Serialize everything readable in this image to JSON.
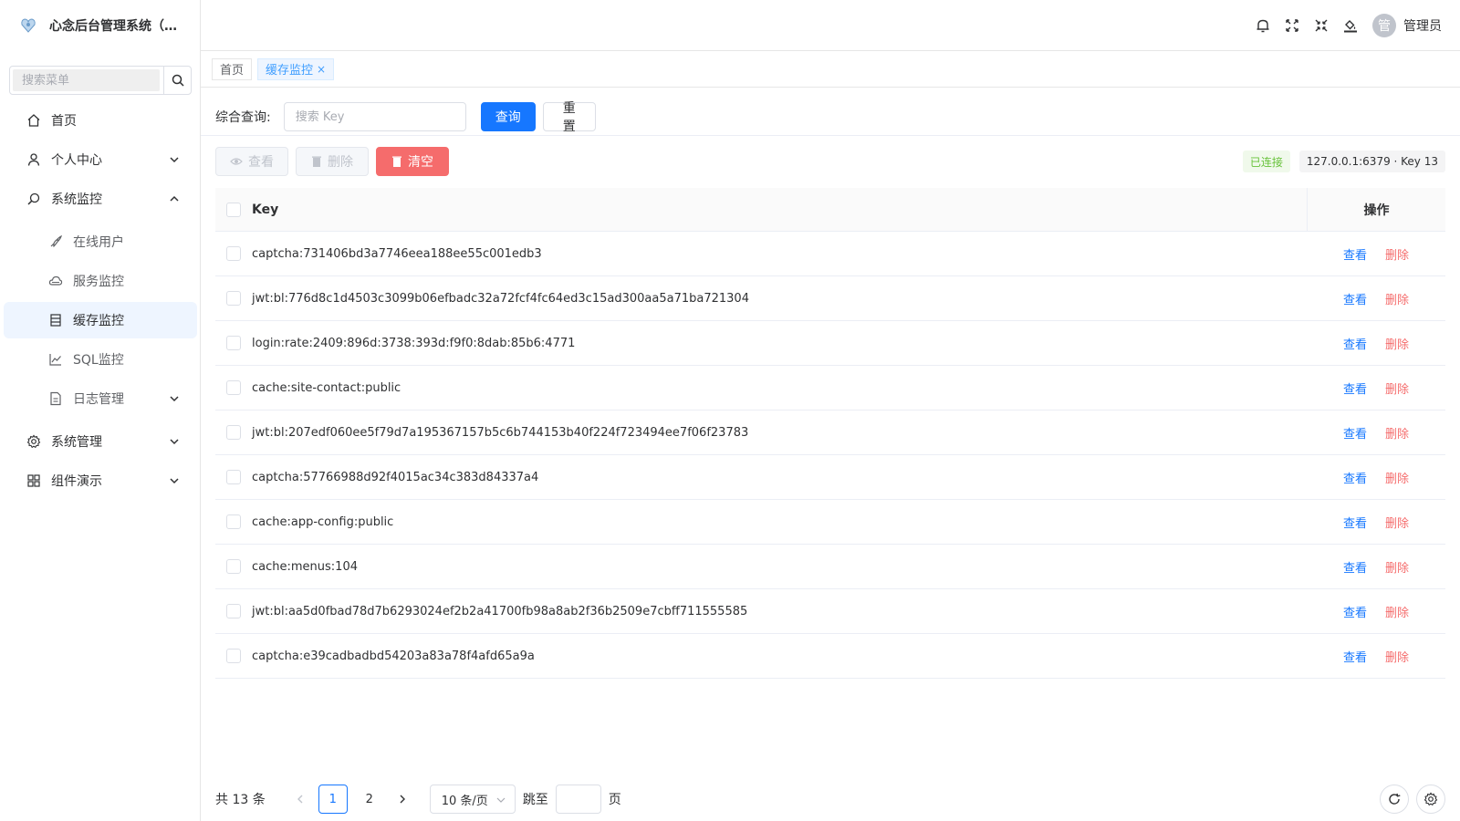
{
  "app": {
    "title": "心念后台管理系统（R..."
  },
  "sidebar": {
    "search_placeholder": "搜索菜单",
    "items": [
      {
        "label": "首页",
        "icon": "home-icon"
      },
      {
        "label": "个人中心",
        "icon": "user-icon"
      },
      {
        "label": "系统监控",
        "icon": "monitor-icon"
      },
      {
        "label": "在线用户",
        "icon": "rocket-icon"
      },
      {
        "label": "服务监控",
        "icon": "cloud-icon"
      },
      {
        "label": "缓存监控",
        "icon": "cache-icon"
      },
      {
        "label": "SQL监控",
        "icon": "line-chart-icon"
      },
      {
        "label": "日志管理",
        "icon": "document-icon"
      },
      {
        "label": "系统管理",
        "icon": "gear-icon"
      },
      {
        "label": "组件演示",
        "icon": "grid-icon"
      }
    ]
  },
  "header": {
    "avatar_text": "管",
    "user_name": "管理员"
  },
  "tabs": [
    {
      "label": "首页"
    },
    {
      "label": "缓存监控",
      "close": "×"
    }
  ],
  "query": {
    "label": "综合查询:",
    "placeholder": "搜索 Key",
    "search_label": "查询",
    "reset_label": "重置"
  },
  "toolbar": {
    "view_label": "查看",
    "delete_label": "删除",
    "clear_label": "清空",
    "status": "已连接",
    "server_info": "127.0.0.1:6379 · Key 13"
  },
  "table": {
    "columns": [
      "Key",
      "操作"
    ],
    "view_label": "查看",
    "delete_label": "删除",
    "rows": [
      "captcha:731406bd3a7746eea188ee55c001edb3",
      "jwt:bl:776d8c1d4503c3099b06efbadc32a72fcf4fc64ed3c15ad300aa5a71ba721304",
      "login:rate:2409:896d:3738:393d:f9f0:8dab:85b6:4771",
      "cache:site-contact:public",
      "jwt:bl:207edf060ee5f79d7a195367157b5c6b744153b40f224f723494ee7f06f23783",
      "captcha:57766988d92f4015ac34c383d84337a4",
      "cache:app-config:public",
      "cache:menus:104",
      "jwt:bl:aa5d0fbad78d7b6293024ef2b2a41700fb98a8ab2f36b2509e7cbff711555585",
      "captcha:e39cadbadbd54203a83a78f4afd65a9a"
    ]
  },
  "pagination": {
    "total": "共 13 条",
    "pages": [
      "1",
      "2"
    ],
    "current": "1",
    "page_size": "10 条/页",
    "jump_label": "跳至",
    "page_label": "页"
  },
  "colors": {
    "primary": "#1677ff",
    "danger": "#f56c6c",
    "success": "#67c23a"
  }
}
